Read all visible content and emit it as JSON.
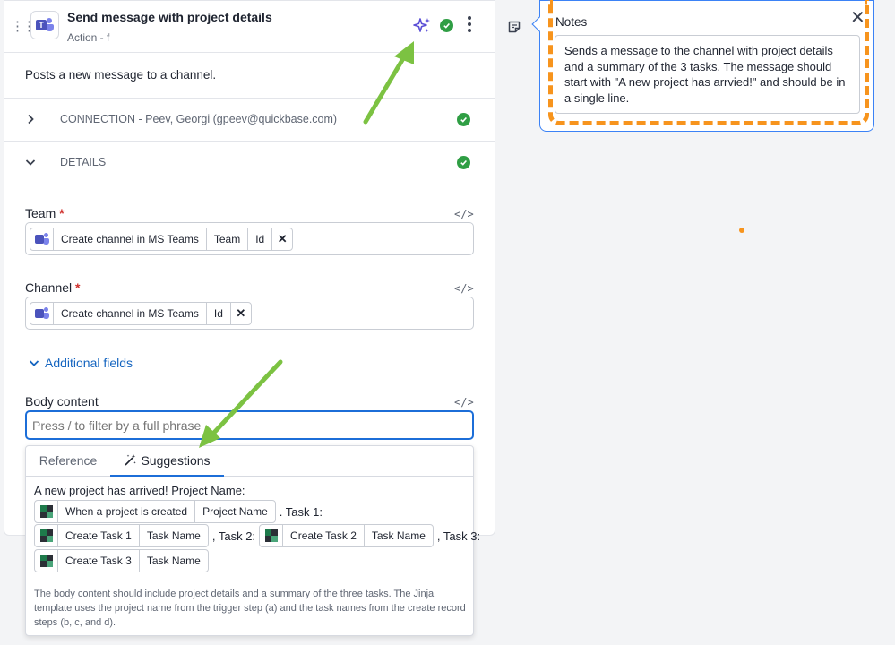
{
  "step": {
    "title": "Send message with project details",
    "subtitle": "Action - f",
    "description": "Posts a new message to a channel."
  },
  "sections": {
    "connection": "CONNECTION - Peev, Georgi (gpeev@quickbase.com)",
    "details": "DETAILS"
  },
  "fields": {
    "team": {
      "label": "Team",
      "required_mark": "*",
      "code_icon": "</>",
      "pill": [
        "Create channel in MS Teams",
        "Team",
        "Id"
      ]
    },
    "channel": {
      "label": "Channel",
      "required_mark": "*",
      "code_icon": "</>",
      "pill": [
        "Create channel in MS Teams",
        "Id"
      ]
    },
    "additional_fields": "Additional fields",
    "body": {
      "label": "Body content",
      "code_icon": "</>",
      "placeholder": "Press / to filter by a full phrase"
    }
  },
  "suggestions_panel": {
    "tabs": [
      "Reference",
      "Suggestions"
    ],
    "active_tab": "Suggestions",
    "heading": "A new project has arrived! Project Name:",
    "trigger_pill": [
      "When a project is created",
      "Project Name"
    ],
    "task1_text": ". Task 1:",
    "task1_pill": [
      "Create Task 1",
      "Task Name"
    ],
    "task2_text": ", Task 2:",
    "task2_pill": [
      "Create Task 2",
      "Task Name"
    ],
    "task3_text": ", Task 3:",
    "task3_pill": [
      "Create Task 3",
      "Task Name"
    ],
    "note": "The body content should include project details and a summary of the three tasks. The Jinja template uses the project name from the trigger step (a) and the task names from the create record steps (b, c, and d)."
  },
  "notes": {
    "title": "Notes",
    "close": "✕",
    "text": "Sends a message to the channel with project details and a summary of the 3 tasks. The message should start with \"A new project has arrvied!\" and should be in a single line."
  },
  "colors": {
    "accent": "#1c6ed8",
    "success": "#2f9e44",
    "annotation_arrow": "#7cc242",
    "annotation_highlight": "#f7941d",
    "teams": "#4b53bc"
  },
  "icons": [
    "drag-handle-icon",
    "teams-icon",
    "sparkle-icon",
    "check-icon",
    "kebab-icon",
    "chevron-right-icon",
    "chevron-down-icon",
    "code-icon",
    "close-icon",
    "magic-wand-icon",
    "quickbase-icon",
    "sticky-note-icon"
  ]
}
